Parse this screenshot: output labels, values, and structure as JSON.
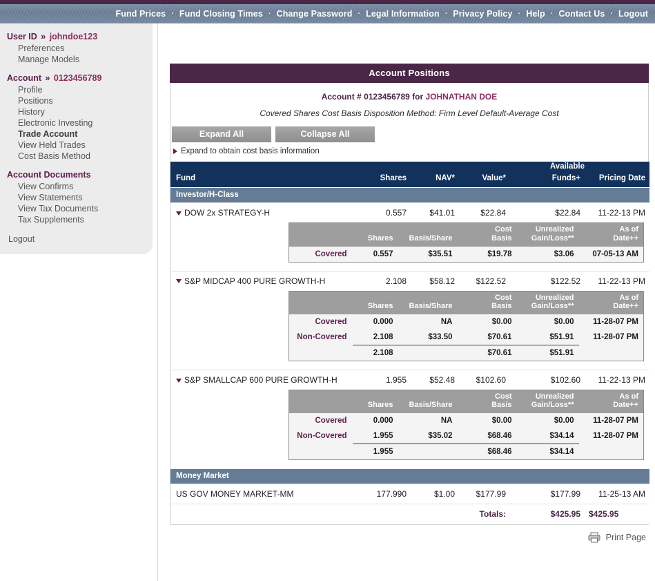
{
  "nav": {
    "separator": "·",
    "links": [
      "Fund Prices",
      "Fund Closing Times",
      "Change Password",
      "Legal Information",
      "Privacy Policy",
      "Help",
      "Contact Us",
      "Logout"
    ]
  },
  "colors": {
    "title_bar": "#4a2746",
    "table_header": "#12325c",
    "section_band": "#647c96",
    "button_gray": "#9e9e9e",
    "accent_purple": "#5c1d4d",
    "accent_magenta": "#8e2a5e",
    "sidebar_bg": "#ececec"
  },
  "sidebar": {
    "groups": [
      {
        "heading_label": "User ID",
        "heading_chevron": "»",
        "heading_value": "johndoe123",
        "items": [
          {
            "label": "Preferences",
            "bold": false
          },
          {
            "label": "Manage Models",
            "bold": false
          }
        ]
      },
      {
        "heading_label": "Account",
        "heading_chevron": "»",
        "heading_value": "0123456789",
        "items": [
          {
            "label": "Profile",
            "bold": false
          },
          {
            "label": "Positions",
            "bold": false
          },
          {
            "label": "History",
            "bold": false
          },
          {
            "label": "Electronic Investing",
            "bold": false
          },
          {
            "label": "Trade Account",
            "bold": true
          },
          {
            "label": "View Held Trades",
            "bold": false
          },
          {
            "label": "Cost Basis Method",
            "bold": false
          }
        ]
      },
      {
        "heading_label": "Account Documents",
        "heading_chevron": "",
        "heading_value": "",
        "items": [
          {
            "label": "View Confirms",
            "bold": false
          },
          {
            "label": "View Statements",
            "bold": false
          },
          {
            "label": "View Tax Documents",
            "bold": false
          },
          {
            "label": "Tax Supplements",
            "bold": false
          }
        ]
      }
    ],
    "logout": "Logout"
  },
  "panel": {
    "title": "Account Positions",
    "account_prefix": "Account # ",
    "account_number": "0123456789",
    "account_for": " for ",
    "account_name": "JOHNATHAN DOE",
    "method_line": "Covered Shares Cost Basis Disposition Method: Firm Level Default-Average Cost",
    "expand_all": "Expand All",
    "collapse_all": "Collapse All",
    "expand_hint": "Expand to obtain cost basis information"
  },
  "table": {
    "headers": {
      "fund": "Fund",
      "shares": "Shares",
      "nav": "NAV*",
      "value": "Value*",
      "available_funds_l1": "Available",
      "available_funds_l2": "Funds+",
      "pricing_date": "Pricing Date"
    },
    "cb_headers": {
      "shares": "Shares",
      "basis_share": "Basis/Share",
      "cost_basis_l1": "Cost",
      "cost_basis_l2": "Basis",
      "unrealized_l1": "Unrealized",
      "unrealized_l2": "Gain/Loss**",
      "asof_l1": "As of",
      "asof_l2": "Date++"
    },
    "sections": [
      {
        "name": "Investor/H-Class",
        "funds": [
          {
            "name": "DOW 2x STRATEGY-H",
            "shares": "0.557",
            "nav": "$41.01",
            "value": "$22.84",
            "available_funds": "$22.84",
            "pricing_date": "11-22-13 PM",
            "cost_basis": {
              "rows": [
                {
                  "label": "Covered",
                  "shares": "0.557",
                  "basis_share": "$35.51",
                  "cost_basis": "$19.78",
                  "unrealized": "$3.06",
                  "asof": "07-05-13 AM"
                }
              ],
              "total": null
            }
          },
          {
            "name": "S&P MIDCAP 400 PURE GROWTH-H",
            "shares": "2.108",
            "nav": "$58.12",
            "value": "$122.52",
            "available_funds": "$122.52",
            "pricing_date": "11-22-13 PM",
            "cost_basis": {
              "rows": [
                {
                  "label": "Covered",
                  "shares": "0.000",
                  "basis_share": "NA",
                  "cost_basis": "$0.00",
                  "unrealized": "$0.00",
                  "asof": "11-28-07 PM"
                },
                {
                  "label": "Non-Covered",
                  "shares": "2.108",
                  "basis_share": "$33.50",
                  "cost_basis": "$70.61",
                  "unrealized": "$51.91",
                  "asof": "11-28-07 PM"
                }
              ],
              "total": {
                "label": "",
                "shares": "2.108",
                "basis_share": "",
                "cost_basis": "$70.61",
                "unrealized": "$51.91",
                "asof": ""
              }
            }
          },
          {
            "name": "S&P SMALLCAP 600 PURE GROWTH-H",
            "shares": "1.955",
            "nav": "$52.48",
            "value": "$102.60",
            "available_funds": "$102.60",
            "pricing_date": "11-22-13 PM",
            "cost_basis": {
              "rows": [
                {
                  "label": "Covered",
                  "shares": "0.000",
                  "basis_share": "NA",
                  "cost_basis": "$0.00",
                  "unrealized": "$0.00",
                  "asof": "11-28-07 PM"
                },
                {
                  "label": "Non-Covered",
                  "shares": "1.955",
                  "basis_share": "$35.02",
                  "cost_basis": "$68.46",
                  "unrealized": "$34.14",
                  "asof": "11-28-07 PM"
                }
              ],
              "total": {
                "label": "",
                "shares": "1.955",
                "basis_share": "",
                "cost_basis": "$68.46",
                "unrealized": "$34.14",
                "asof": ""
              }
            }
          }
        ]
      },
      {
        "name": "Money Market",
        "funds": [
          {
            "name": "US GOV MONEY MARKET-MM",
            "shares": "177.990",
            "nav": "$1.00",
            "value": "$177.99",
            "available_funds": "$177.99",
            "pricing_date": "11-25-13 AM",
            "cost_basis": null
          }
        ]
      }
    ],
    "totals": {
      "label": "Totals:",
      "value": "$425.95",
      "available_funds": "$425.95"
    }
  },
  "footer": {
    "print_label": "Print Page"
  }
}
